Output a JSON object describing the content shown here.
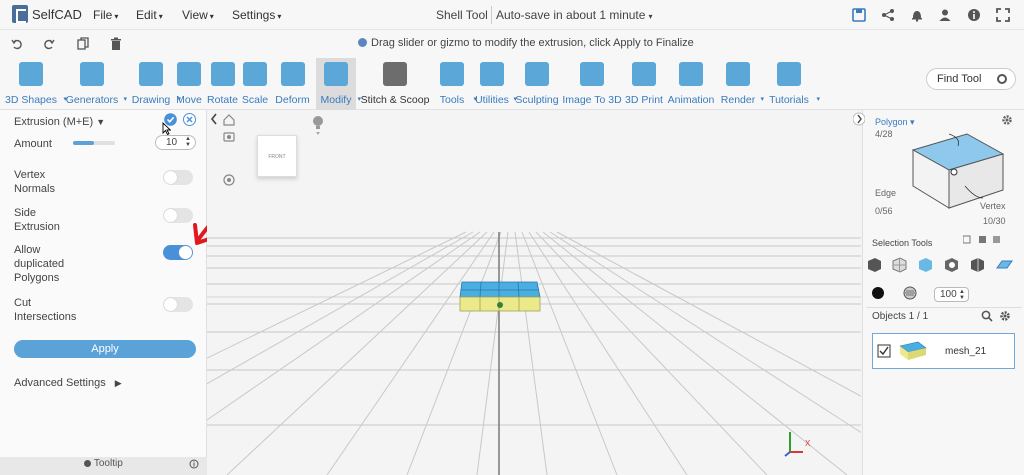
{
  "app": {
    "name": "SelfCAD"
  },
  "menu": {
    "file": "File",
    "edit": "Edit",
    "view": "View",
    "settings": "Settings"
  },
  "document": {
    "title": "Shell Tool",
    "autosave": "Auto-save in about 1 minute"
  },
  "hint": "Drag slider or gizmo to modify the extrusion, click Apply to Finalize",
  "toolbar": [
    {
      "label": "3D Shapes",
      "icon": "cube-icon",
      "dropdown": true
    },
    {
      "label": "Generators",
      "icon": "generator-icon",
      "dropdown": true
    },
    {
      "label": "Drawing",
      "icon": "drawing-icon",
      "dropdown": true
    },
    {
      "label": "Move",
      "icon": "move-icon"
    },
    {
      "label": "Rotate",
      "icon": "rotate-icon"
    },
    {
      "label": "Scale",
      "icon": "scale-icon"
    },
    {
      "label": "Deform",
      "icon": "deform-icon",
      "dropdown": true
    },
    {
      "label": "Modify",
      "icon": "modify-icon",
      "dropdown": true,
      "active": true
    },
    {
      "label": "Stitch & Scoop",
      "icon": "stitch-scoop-icon"
    },
    {
      "label": "Tools",
      "icon": "tools-icon",
      "dropdown": true
    },
    {
      "label": "Utilities",
      "icon": "utilities-icon",
      "dropdown": true
    },
    {
      "label": "Sculpting",
      "icon": "sculpting-icon"
    },
    {
      "label": "Image To 3D",
      "icon": "image-to-3d-icon"
    },
    {
      "label": "3D Print",
      "icon": "3d-print-icon"
    },
    {
      "label": "Animation",
      "icon": "animation-icon"
    },
    {
      "label": "Render",
      "icon": "render-icon",
      "dropdown": true
    },
    {
      "label": "Tutorials",
      "icon": "tutorials-icon",
      "dropdown": true
    }
  ],
  "find_tool": {
    "placeholder": "Find Tool"
  },
  "extrusion_panel": {
    "title": "Extrusion (M+E)",
    "amount_label": "Amount",
    "amount_value": "10",
    "amount_slider_fraction": 0.5,
    "options": [
      {
        "label_lines": [
          "Vertex",
          "Normals"
        ],
        "on": false
      },
      {
        "label_lines": [
          "Side",
          "Extrusion"
        ],
        "on": false
      },
      {
        "label_lines": [
          "Allow",
          "duplicated",
          "Polygons"
        ],
        "on": true
      },
      {
        "label_lines": [
          "Cut",
          "Intersections"
        ],
        "on": false
      }
    ],
    "apply_label": "Apply",
    "advanced_label": "Advanced Settings",
    "tooltip_label": "Tooltip"
  },
  "view_cube": {
    "face_label": "FRONT"
  },
  "right_panel": {
    "polygon_label": "Polygon",
    "polygon_count": "4/28",
    "edge_label": "Edge",
    "edge_count": "0/56",
    "vertex_label": "Vertex",
    "vertex_count": "10/30",
    "selection_tools_label": "Selection Tools",
    "brush_size": "100",
    "objects_label": "Objects 1 / 1",
    "object_name": "mesh_21"
  },
  "colors": {
    "accent": "#5aa7d8",
    "toggle_on": "#4a90d9",
    "annotation": "#e0191f",
    "mesh_top": "#4aaee0",
    "mesh_side": "#ece98a"
  }
}
